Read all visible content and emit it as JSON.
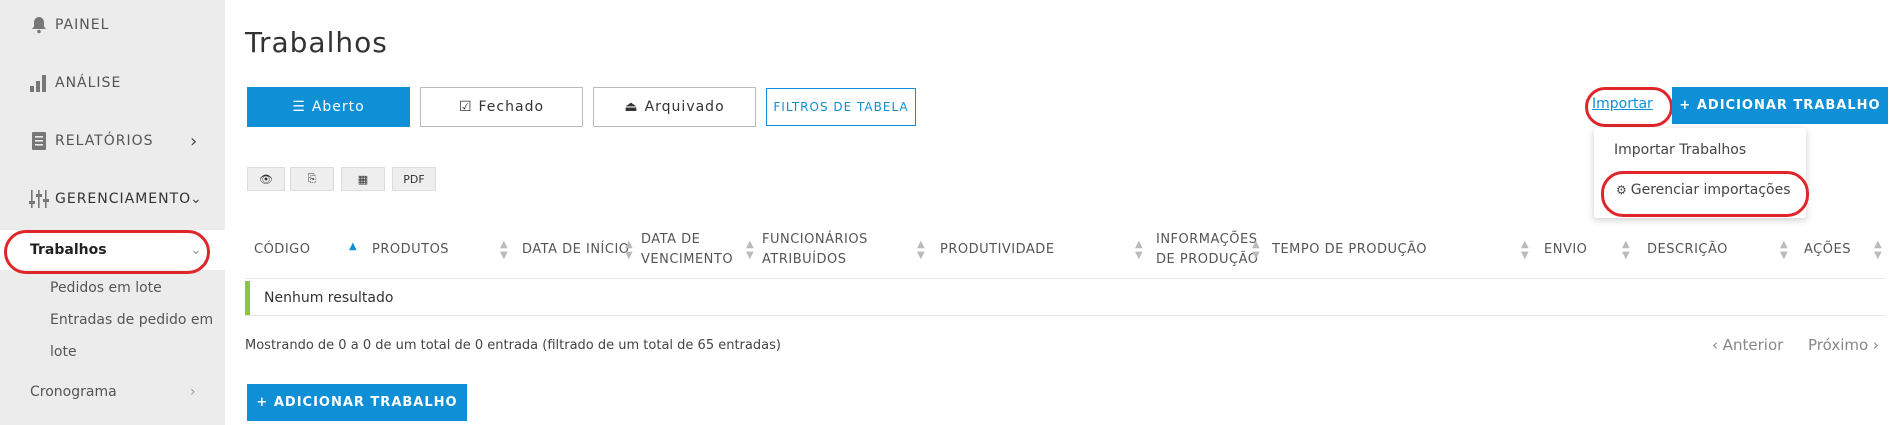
{
  "sidebar": {
    "items": [
      {
        "label": "PAINEL",
        "icon": "bell-icon"
      },
      {
        "label": "ANÁLISE",
        "icon": "bar-chart-icon"
      },
      {
        "label": "RELATÓRIOS",
        "icon": "reports-icon"
      },
      {
        "label": "GERENCIAMENTO",
        "icon": "sliders-icon"
      }
    ],
    "active_sub": "Trabalhos",
    "sub_links": [
      "Pedidos em lote",
      "Entradas de pedido em",
      "lote"
    ],
    "schedule": "Cronograma"
  },
  "page": {
    "title": "Trabalhos"
  },
  "tabs": [
    {
      "label": "Aberto",
      "icon": "list-icon"
    },
    {
      "label": "Fechado",
      "icon": "checkbox-icon"
    },
    {
      "label": "Arquivado",
      "icon": "inbox-icon"
    }
  ],
  "filters_label": "FILTROS DE TABELA",
  "import_link": "Importar",
  "add_job_label": "+ ADICIONAR TRABALHO",
  "import_menu": [
    "Importar Trabalhos",
    "Gerenciar importações"
  ],
  "export_buttons": [
    "eye-icon",
    "copy-icon",
    "table-icon",
    "PDF"
  ],
  "table": {
    "headers": [
      [
        "CÓDIGO"
      ],
      [
        "PRODUTOS"
      ],
      [
        "DATA DE INÍCIO"
      ],
      [
        "DATA DE",
        "VENCIMENTO"
      ],
      [
        "FUNCIONÁRIOS",
        "ATRIBUÍDOS"
      ],
      [
        "PRODUTIVIDADE"
      ],
      [
        "INFORMAÇÕES",
        "DE PRODUÇÃO"
      ],
      [
        "TEMPO DE PRODUÇÃO"
      ],
      [
        "ENVIO"
      ],
      [
        "DESCRIÇÃO"
      ],
      [
        "AÇÕES"
      ]
    ],
    "empty_text": "Nenhum resultado"
  },
  "footer": {
    "info": "Mostrando de 0 a 0 de um total de 0 entrada (filtrado de um total de 65 entradas)",
    "prev": "‹ Anterior",
    "next": "Próximo ›",
    "add_label": "+ ADICIONAR TRABALHO"
  },
  "colors": {
    "accent": "#0e8fd6",
    "highlight": "#e0262b",
    "success": "#8cc63f"
  }
}
